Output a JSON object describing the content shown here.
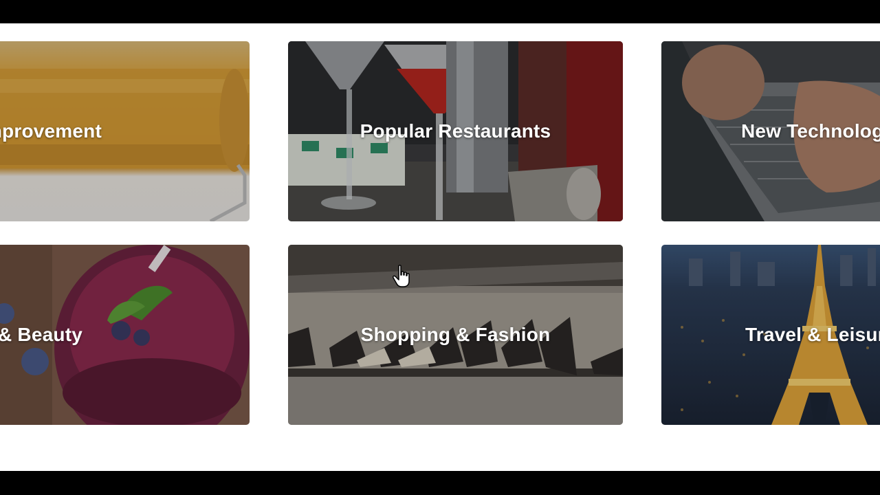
{
  "categories": [
    {
      "label": "Home Improvement",
      "theme": "paint-roller"
    },
    {
      "label": "Popular Restaurants",
      "theme": "cocktail-glasses"
    },
    {
      "label": "New Technology",
      "theme": "laptop-typing"
    },
    {
      "label": "Health & Beauty",
      "theme": "berry-smoothie"
    },
    {
      "label": "Shopping & Fashion",
      "theme": "shoe-shelf"
    },
    {
      "label": "Travel & Leisure",
      "theme": "eiffel-tower-night"
    }
  ],
  "colors": {
    "page_background": "#ffffff",
    "letterbox": "#000000",
    "label_text": "#ffffff"
  },
  "cursor": "hand-pointer-icon"
}
